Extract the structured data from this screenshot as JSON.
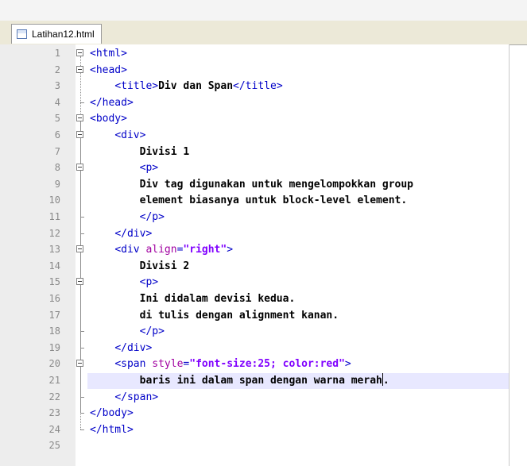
{
  "tab": {
    "filename": "Latihan12.html"
  },
  "editor": {
    "lines": [
      {
        "num": "1",
        "indent": "",
        "parts": [
          {
            "t": "<html>",
            "c": "tag"
          }
        ],
        "fold": "box"
      },
      {
        "num": "2",
        "indent": "",
        "parts": [
          {
            "t": "<head>",
            "c": "tag"
          }
        ],
        "fold": "box"
      },
      {
        "num": "3",
        "indent": "    ",
        "parts": [
          {
            "t": "<title>",
            "c": "tag"
          },
          {
            "t": "Div dan Span",
            "c": "txt"
          },
          {
            "t": "</title>",
            "c": "tag"
          }
        ],
        "fold": "line"
      },
      {
        "num": "4",
        "indent": "",
        "parts": [
          {
            "t": "</head>",
            "c": "tag"
          }
        ],
        "fold": "end"
      },
      {
        "num": "5",
        "indent": "",
        "parts": [
          {
            "t": "<body>",
            "c": "tag"
          }
        ],
        "fold": "box"
      },
      {
        "num": "6",
        "indent": "    ",
        "parts": [
          {
            "t": "<div>",
            "c": "tag"
          }
        ],
        "fold": "box"
      },
      {
        "num": "7",
        "indent": "        ",
        "parts": [
          {
            "t": "Divisi 1",
            "c": "txt"
          }
        ],
        "fold": "line"
      },
      {
        "num": "8",
        "indent": "        ",
        "parts": [
          {
            "t": "<p>",
            "c": "tag"
          }
        ],
        "fold": "box"
      },
      {
        "num": "9",
        "indent": "        ",
        "parts": [
          {
            "t": "Div tag digunakan untuk mengelompokkan group",
            "c": "txt"
          }
        ],
        "fold": "line"
      },
      {
        "num": "10",
        "indent": "        ",
        "parts": [
          {
            "t": "element biasanya untuk block-level element.",
            "c": "txt"
          }
        ],
        "fold": "line"
      },
      {
        "num": "11",
        "indent": "        ",
        "parts": [
          {
            "t": "</p>",
            "c": "tag"
          }
        ],
        "fold": "end"
      },
      {
        "num": "12",
        "indent": "    ",
        "parts": [
          {
            "t": "</div>",
            "c": "tag"
          }
        ],
        "fold": "end"
      },
      {
        "num": "13",
        "indent": "    ",
        "parts": [
          {
            "t": "<div ",
            "c": "tag"
          },
          {
            "t": "align",
            "c": "attr"
          },
          {
            "t": "=",
            "c": "tag"
          },
          {
            "t": "\"right\"",
            "c": "str"
          },
          {
            "t": ">",
            "c": "tag"
          }
        ],
        "fold": "box"
      },
      {
        "num": "14",
        "indent": "        ",
        "parts": [
          {
            "t": "Divisi 2",
            "c": "txt"
          }
        ],
        "fold": "line"
      },
      {
        "num": "15",
        "indent": "        ",
        "parts": [
          {
            "t": "<p>",
            "c": "tag"
          }
        ],
        "fold": "box"
      },
      {
        "num": "16",
        "indent": "        ",
        "parts": [
          {
            "t": "Ini didalam devisi kedua.",
            "c": "txt"
          }
        ],
        "fold": "line"
      },
      {
        "num": "17",
        "indent": "        ",
        "parts": [
          {
            "t": "di tulis dengan alignment kanan.",
            "c": "txt"
          }
        ],
        "fold": "line"
      },
      {
        "num": "18",
        "indent": "        ",
        "parts": [
          {
            "t": "</p>",
            "c": "tag"
          }
        ],
        "fold": "end"
      },
      {
        "num": "19",
        "indent": "    ",
        "parts": [
          {
            "t": "</div>",
            "c": "tag"
          }
        ],
        "fold": "end"
      },
      {
        "num": "20",
        "indent": "    ",
        "parts": [
          {
            "t": "<span ",
            "c": "tag"
          },
          {
            "t": "style",
            "c": "attr"
          },
          {
            "t": "=",
            "c": "tag"
          },
          {
            "t": "\"font-size:25; color:red\"",
            "c": "str"
          },
          {
            "t": ">",
            "c": "tag"
          }
        ],
        "fold": "box"
      },
      {
        "num": "21",
        "indent": "        ",
        "parts": [
          {
            "t": "baris ini dalam span dengan warna merah",
            "c": "txt"
          },
          {
            "t": "|caret|",
            "c": "caret"
          },
          {
            "t": ".",
            "c": "txt"
          }
        ],
        "fold": "line",
        "highlight": true
      },
      {
        "num": "22",
        "indent": "    ",
        "parts": [
          {
            "t": "</span>",
            "c": "tag"
          }
        ],
        "fold": "end"
      },
      {
        "num": "23",
        "indent": "",
        "parts": [
          {
            "t": "</body>",
            "c": "tag"
          }
        ],
        "fold": "end"
      },
      {
        "num": "24",
        "indent": "",
        "parts": [
          {
            "t": "</html>",
            "c": "tag"
          }
        ],
        "fold": "end"
      },
      {
        "num": "25",
        "indent": "",
        "parts": [],
        "fold": "none"
      }
    ]
  },
  "colors": {
    "tag": "#0000c8",
    "attr": "#a000a0",
    "string": "#8000ff",
    "highlight": "#e8e8ff",
    "gutter": "#ededed"
  }
}
